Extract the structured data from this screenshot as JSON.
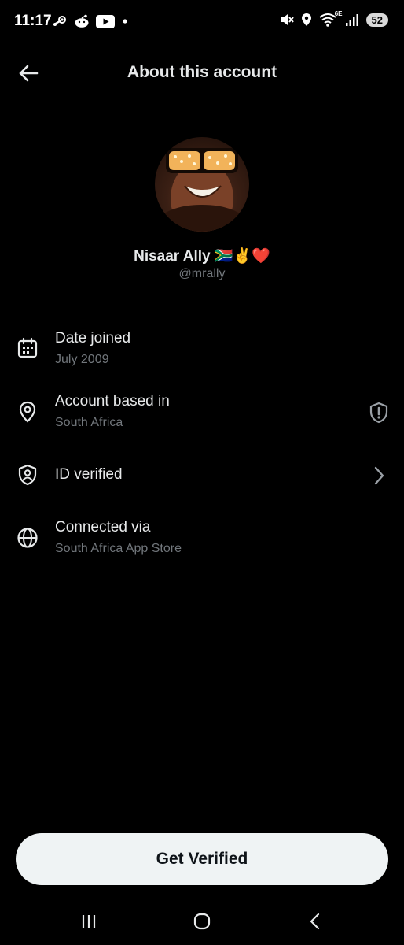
{
  "status_bar": {
    "time": "11:17",
    "left_icons": [
      "steam-icon",
      "reddit-icon",
      "youtube-icon",
      "notification-dot-icon"
    ],
    "right_icons": [
      "mute-icon",
      "location-icon",
      "wifi-6e-icon",
      "signal-icon"
    ],
    "network_label": "6E",
    "battery": "52"
  },
  "header": {
    "title": "About this account",
    "back_icon": "arrow-left-icon"
  },
  "profile": {
    "name": "Nisaar Ally 🇿🇦✌️❤️",
    "handle": "@mrally"
  },
  "info_rows": [
    {
      "icon": "calendar-icon",
      "label": "Date joined",
      "value": "July 2009"
    },
    {
      "icon": "location-pin-icon",
      "label": "Account based in",
      "value": "South Africa",
      "right_icon": "shield-alert-icon"
    },
    {
      "icon": "shield-person-icon",
      "label": "ID verified",
      "right_icon": "chevron-right-icon"
    },
    {
      "icon": "globe-icon",
      "label": "Connected via",
      "value": "South Africa App Store"
    }
  ],
  "cta": {
    "label": "Get Verified"
  },
  "nav_bar": [
    "recent-apps-icon",
    "home-icon",
    "back-icon"
  ],
  "colors": {
    "background": "#000000",
    "primary_text": "#e7e9ea",
    "secondary_text": "#71767b",
    "button_bg": "#eff3f4",
    "button_text": "#0f1419"
  }
}
